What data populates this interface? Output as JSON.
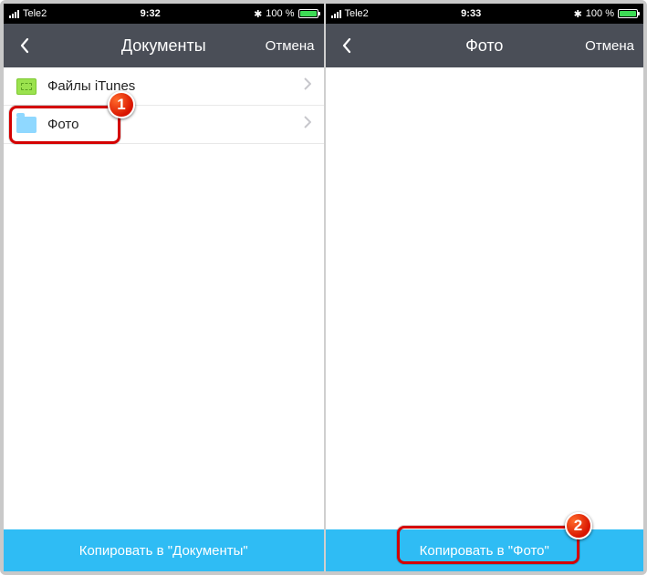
{
  "left": {
    "statusbar": {
      "carrier": "Tele2",
      "time": "9:32",
      "battery": "100 %",
      "bluetooth": "✱"
    },
    "navbar": {
      "title": "Документы",
      "cancel": "Отмена"
    },
    "rows": [
      {
        "icon": "itunes-folder",
        "label": "Файлы iTunes"
      },
      {
        "icon": "folder",
        "label": "Фото"
      }
    ],
    "action": "Копировать в \"Документы\"",
    "badge": "1"
  },
  "right": {
    "statusbar": {
      "carrier": "Tele2",
      "time": "9:33",
      "battery": "100 %",
      "bluetooth": "✱"
    },
    "navbar": {
      "title": "Фото",
      "cancel": "Отмена"
    },
    "action": "Копировать в \"Фото\"",
    "badge": "2"
  }
}
